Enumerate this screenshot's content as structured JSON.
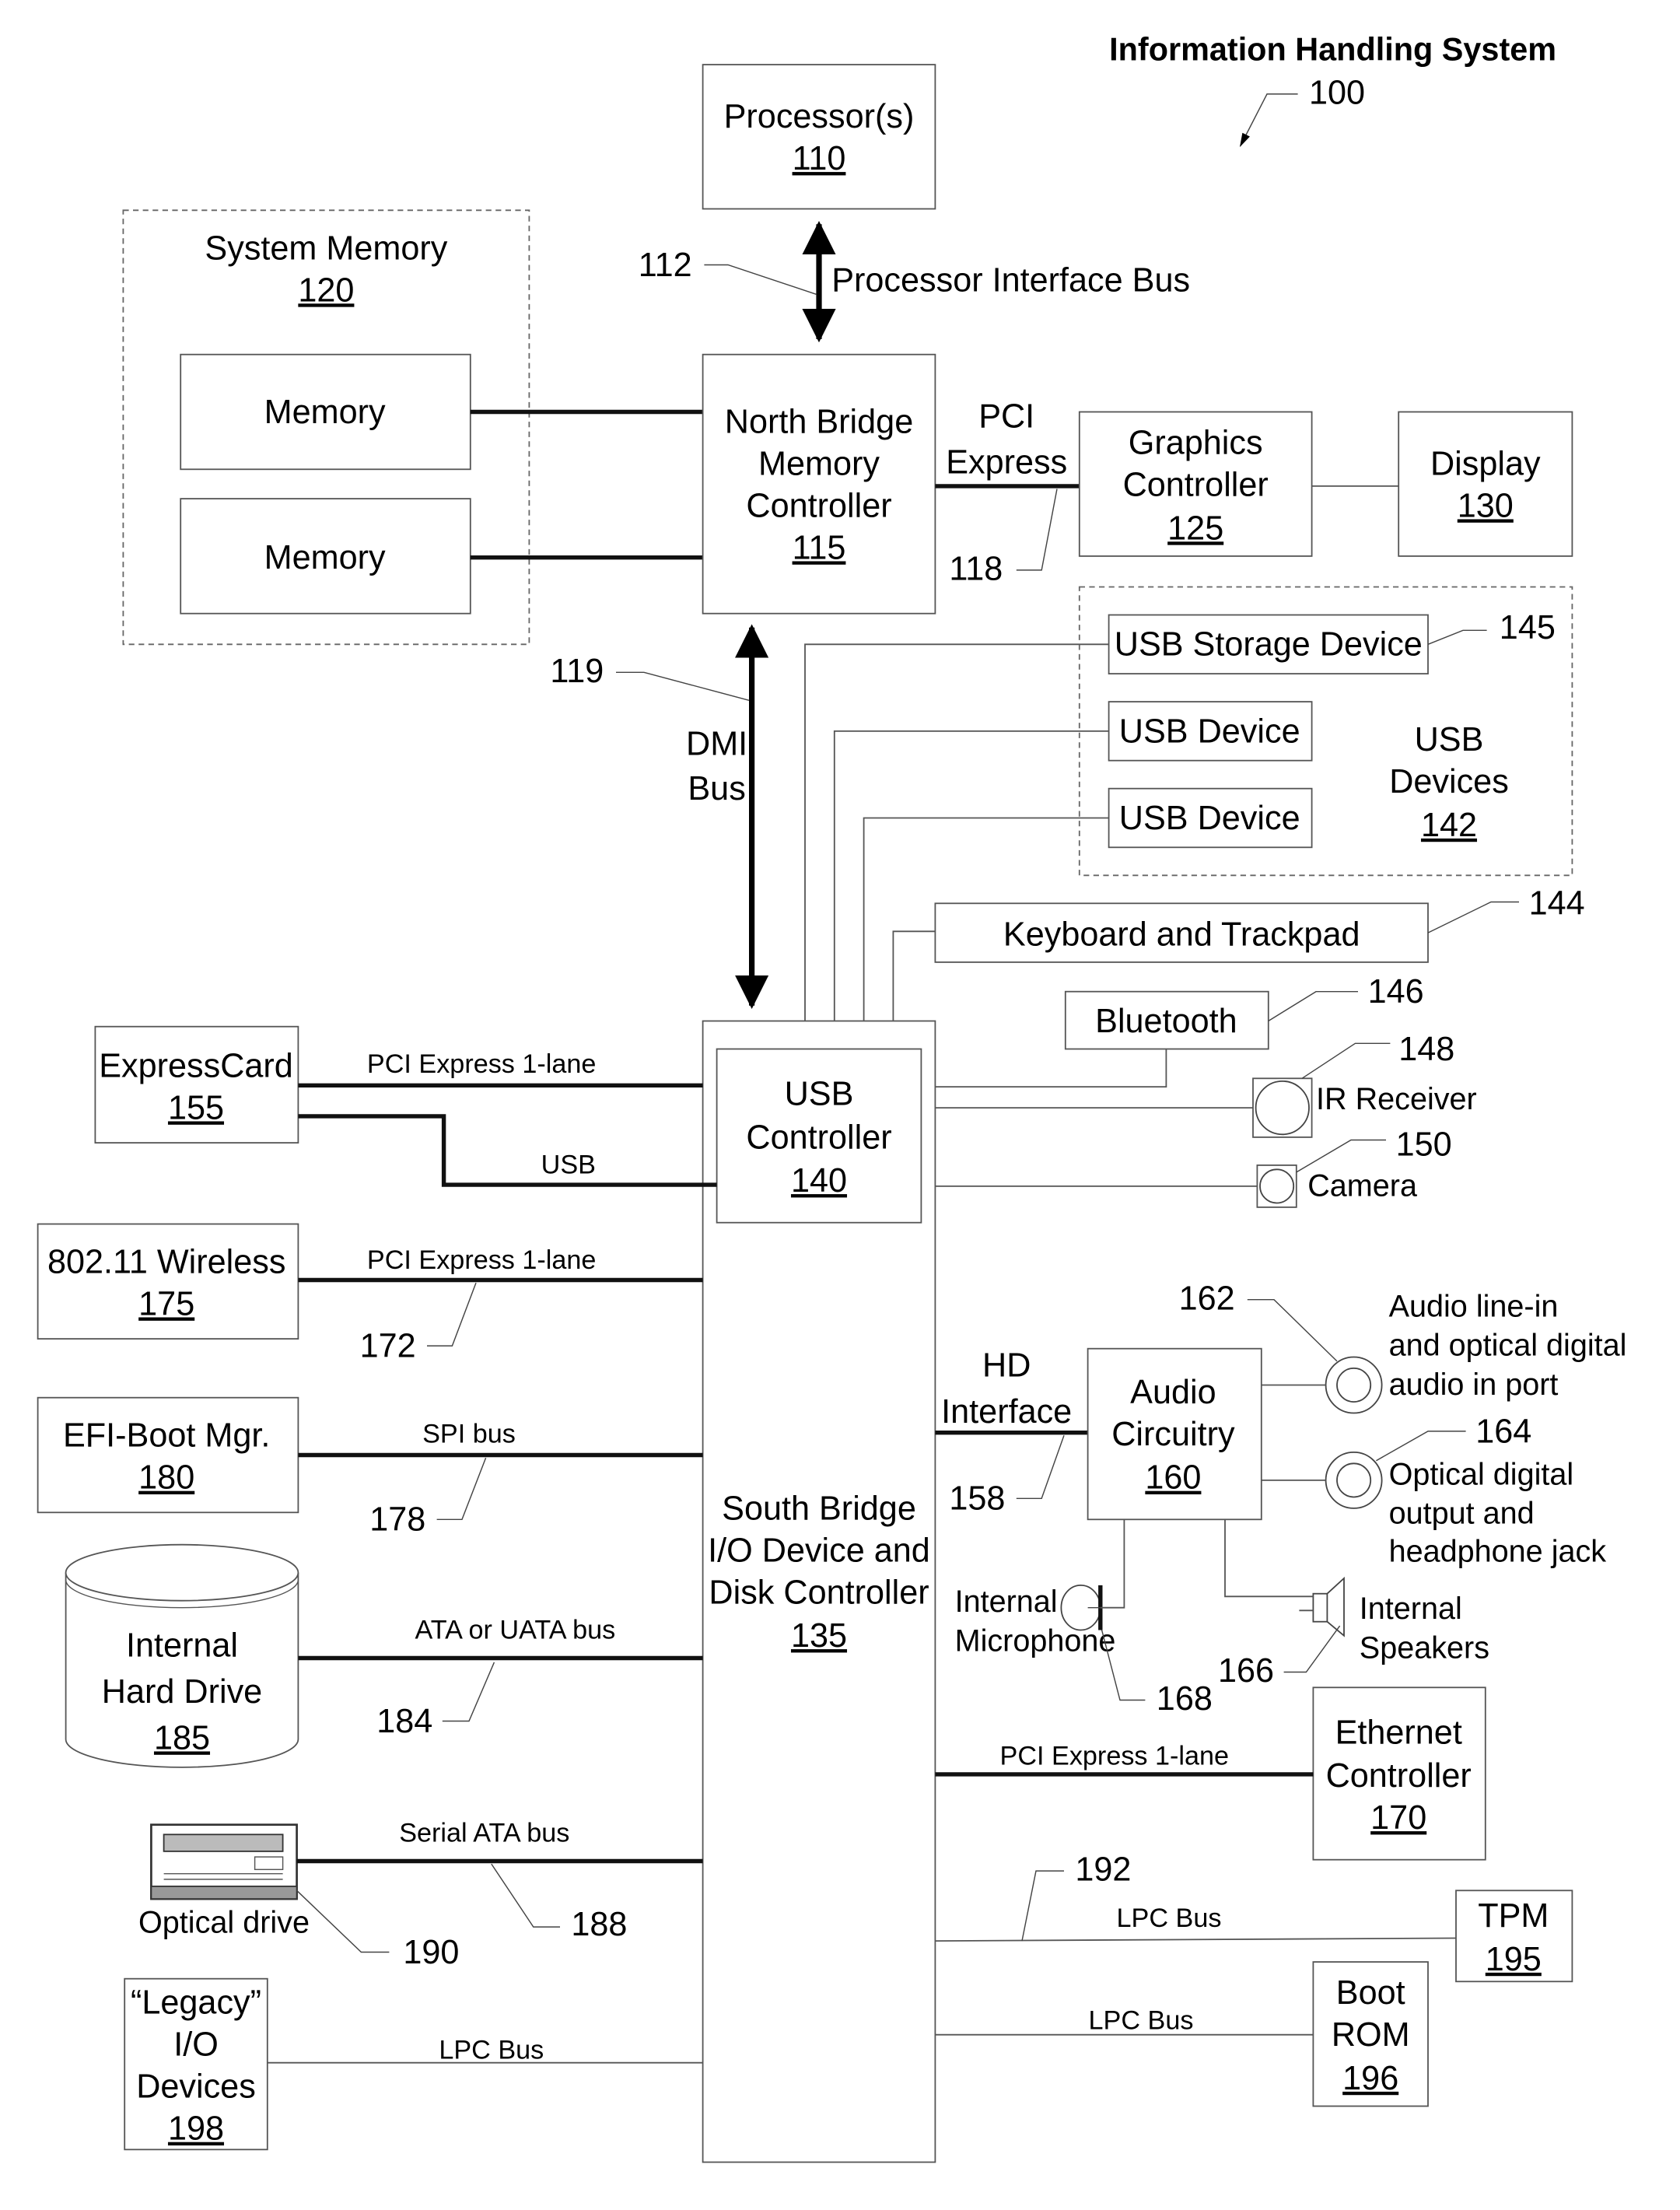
{
  "title": "Information Handling System",
  "system_ref": "100",
  "components": {
    "processor": {
      "name": "Processor(s)",
      "ref": "110"
    },
    "system_memory": {
      "name": "System Memory",
      "ref": "120",
      "modules": [
        "Memory",
        "Memory"
      ]
    },
    "north_bridge": {
      "lines": [
        "North Bridge",
        "Memory",
        "Controller"
      ],
      "ref": "115"
    },
    "graphics": {
      "lines": [
        "Graphics",
        "Controller"
      ],
      "ref": "125"
    },
    "display": {
      "name": "Display",
      "ref": "130"
    },
    "usb_devices": {
      "lines": [
        "USB",
        "Devices"
      ],
      "ref": "142",
      "items": [
        "USB Storage Device",
        "USB Device",
        "USB Device"
      ]
    },
    "keyboard": {
      "name": "Keyboard and Trackpad"
    },
    "bluetooth": {
      "name": "Bluetooth"
    },
    "ir_receiver": {
      "name": "IR Receiver"
    },
    "camera": {
      "name": "Camera"
    },
    "usb_controller": {
      "lines": [
        "USB",
        "Controller"
      ],
      "ref": "140"
    },
    "expresscard": {
      "name": "ExpressCard",
      "ref": "155"
    },
    "wireless": {
      "name": "802.11 Wireless",
      "ref": "175"
    },
    "efi": {
      "name": "EFI-Boot Mgr.",
      "ref": "180"
    },
    "hard_drive": {
      "lines": [
        "Internal",
        "Hard Drive"
      ],
      "ref": "185"
    },
    "optical": {
      "name": "Optical drive"
    },
    "legacy": {
      "lines": [
        "“Legacy”",
        "I/O",
        "Devices"
      ],
      "ref": "198"
    },
    "south_bridge": {
      "lines": [
        "South Bridge",
        "I/O Device and",
        "Disk Controller"
      ],
      "ref": "135"
    },
    "audio": {
      "lines": [
        "Audio",
        "Circuitry"
      ],
      "ref": "160"
    },
    "audio_in": {
      "lines": [
        "Audio line-in",
        "and optical digital",
        "audio in port"
      ]
    },
    "audio_out": {
      "lines": [
        "Optical digital",
        "output and",
        "headphone jack"
      ]
    },
    "microphone": {
      "lines": [
        "Internal",
        "Microphone"
      ]
    },
    "speakers": {
      "lines": [
        "Internal",
        "Speakers"
      ]
    },
    "ethernet": {
      "lines": [
        "Ethernet",
        "Controller"
      ],
      "ref": "170"
    },
    "tpm": {
      "name": "TPM",
      "ref": "195"
    },
    "boot_rom": {
      "lines": [
        "Boot",
        "ROM"
      ],
      "ref": "196"
    }
  },
  "buses": {
    "processor_bus": "Processor Interface Bus",
    "pci_express": [
      "PCI",
      "Express"
    ],
    "dmi": [
      "DMI",
      "Bus"
    ],
    "hd_interface": [
      "HD",
      "Interface"
    ],
    "expresscard_pcie": "PCI Express 1-lane",
    "expresscard_usb": "USB",
    "wireless_pcie": "PCI Express 1-lane",
    "spi": "SPI bus",
    "ata": "ATA or UATA bus",
    "sata": "Serial ATA bus",
    "lpc_legacy": "LPC Bus",
    "ethernet_pcie": "PCI Express 1-lane",
    "lpc_tpm": "LPC Bus",
    "lpc_rom": "LPC Bus"
  },
  "refs": {
    "r112": "112",
    "r118": "118",
    "r119": "119",
    "r144": "144",
    "r145": "145",
    "r146": "146",
    "r148": "148",
    "r150": "150",
    "r158": "158",
    "r162": "162",
    "r164": "164",
    "r166": "166",
    "r168": "168",
    "r172": "172",
    "r178": "178",
    "r184": "184",
    "r188": "188",
    "r190": "190",
    "r192": "192"
  }
}
